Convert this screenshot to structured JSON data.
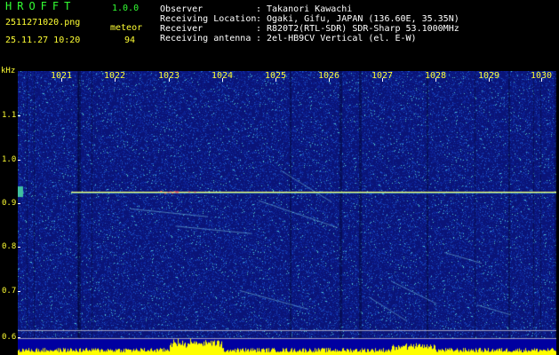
{
  "header": {
    "app_title": "HROFFT",
    "app_version": "1.0.0",
    "filename": "2511271020.png",
    "datetime": "25.11.27 10:20",
    "meteor_label": "meteor",
    "meteor_count": "94"
  },
  "info": [
    {
      "label": "Observer",
      "sep": ":",
      "value": "Takanori Kawachi"
    },
    {
      "label": "Receiving Location",
      "sep": ":",
      "value": "Ogaki, Gifu, JAPAN (136.60E, 35.35N)"
    },
    {
      "label": "Receiver",
      "sep": ":",
      "value": "R820T2(RTL-SDR) SDR-Sharp 53.1000MHz"
    },
    {
      "label": "Receiving antenna",
      "sep": ":",
      "value": "2el-HB9CV Vertical (el. E-W)"
    }
  ],
  "axis": {
    "y_title": "kHz",
    "y_ticks": [
      "1.1",
      "1.0",
      "0.9",
      "0.8",
      "0.7",
      "0.6"
    ],
    "x_ticks": [
      "1021",
      "1022",
      "1023",
      "1024",
      "1025",
      "1026",
      "1027",
      "1028",
      "1029",
      "1030"
    ]
  },
  "colors": {
    "background": "#000000",
    "waterfall_base": "#0a1478",
    "signal_line": "#ffff66",
    "noise_band": "#ffff00",
    "header_green": "#33ff33",
    "header_yellow": "#ffff33",
    "header_white": "#ffffff"
  }
}
